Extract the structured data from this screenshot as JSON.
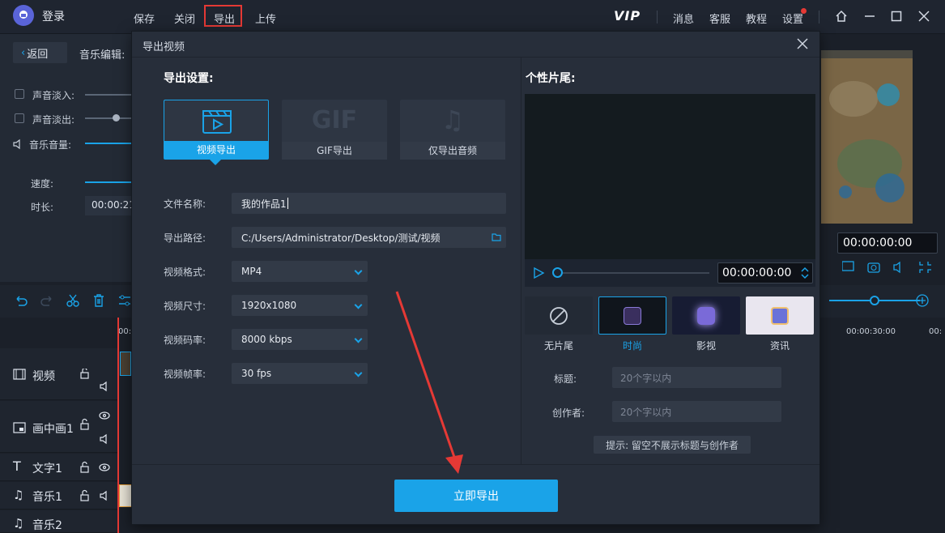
{
  "app": {
    "login": "登录"
  },
  "menu": [
    "保存",
    "关闭",
    "导出",
    "上传"
  ],
  "topright": {
    "vip": "VIP",
    "items": [
      "消息",
      "客服",
      "教程",
      "设置"
    ]
  },
  "left_panel": {
    "back": "返回",
    "music_edit": "音乐编辑:",
    "fade_in": "声音淡入:",
    "fade_out": "声音淡出:",
    "volume": "音乐音量:",
    "speed": "速度:",
    "duration": "时长:",
    "duration_value": "00:00:21"
  },
  "preview": {
    "time": "00:00:00:00"
  },
  "timeline": {
    "ruler_start": "00:",
    "ruler_mark": "00:00:30:00",
    "tracks": [
      "视频",
      "画中画1",
      "文字1",
      "音乐1",
      "音乐2"
    ]
  },
  "dialog": {
    "title": "导出视频",
    "settings_title": "导出设置:",
    "export_types": [
      "视频导出",
      "GIF导出",
      "仅导出音频"
    ],
    "gif_glyph": "GIF",
    "fields": {
      "filename_label": "文件名称:",
      "filename": "我的作品1",
      "path_label": "导出路径:",
      "path": "C:/Users/Administrator/Desktop/测试/视频",
      "format_label": "视频格式:",
      "format": "MP4",
      "size_label": "视频尺寸:",
      "size": "1920x1080",
      "bitrate_label": "视频码率:",
      "bitrate": "8000 kbps",
      "fps_label": "视频帧率:",
      "fps": "30 fps"
    },
    "trailer": {
      "title": "个性片尾:",
      "time": "00:00:00:00",
      "styles": [
        "无片尾",
        "时尚",
        "影视",
        "资讯"
      ],
      "selected_style": "时尚",
      "title_label": "标题:",
      "title_placeholder": "20个字以内",
      "author_label": "创作者:",
      "author_placeholder": "20个字以内",
      "hint": "提示: 留空不展示标题与创作者"
    },
    "export_button": "立即导出"
  },
  "colors": {
    "accent": "#1aa3e8",
    "highlight": "#e53935",
    "bg": "#1b2029",
    "dialog_bg": "#272e3a"
  }
}
